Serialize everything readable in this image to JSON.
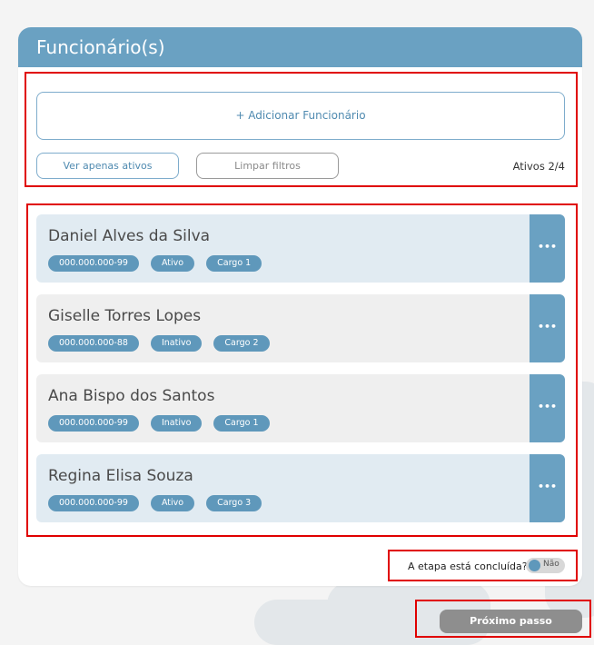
{
  "header": {
    "title": "Funcionário(s)"
  },
  "toolbar": {
    "add_label": "+ Adicionar Funcionário",
    "active_only_label": "Ver apenas ativos",
    "clear_filters_label": "Limpar filtros",
    "active_count": "Ativos 2/4"
  },
  "employees": [
    {
      "name": "Daniel Alves da Silva",
      "doc": "000.000.000-99",
      "status": "Ativo",
      "role": "Cargo 1"
    },
    {
      "name": "Giselle Torres Lopes",
      "doc": "000.000.000-88",
      "status": "Inativo",
      "role": "Cargo 2"
    },
    {
      "name": "Ana Bispo dos Santos",
      "doc": "000.000.000-99",
      "status": "Inativo",
      "role": "Cargo 1"
    },
    {
      "name": "Regina Elisa Souza",
      "doc": "000.000.000-99",
      "status": "Ativo",
      "role": "Cargo 3"
    }
  ],
  "more_icon": "ellipsis-icon",
  "more_label": "•••",
  "stage": {
    "question": "A etapa está concluída?",
    "toggle_label": "Não"
  },
  "footer": {
    "next_label": "Próximo passo"
  },
  "colors": {
    "accent": "#6aa1c2",
    "badge": "#5f98bb",
    "row_active_bg": "#e1ebf2",
    "row_inactive_bg": "#efefef",
    "highlight": "#e00000",
    "next_button": "#8e8e8e"
  }
}
